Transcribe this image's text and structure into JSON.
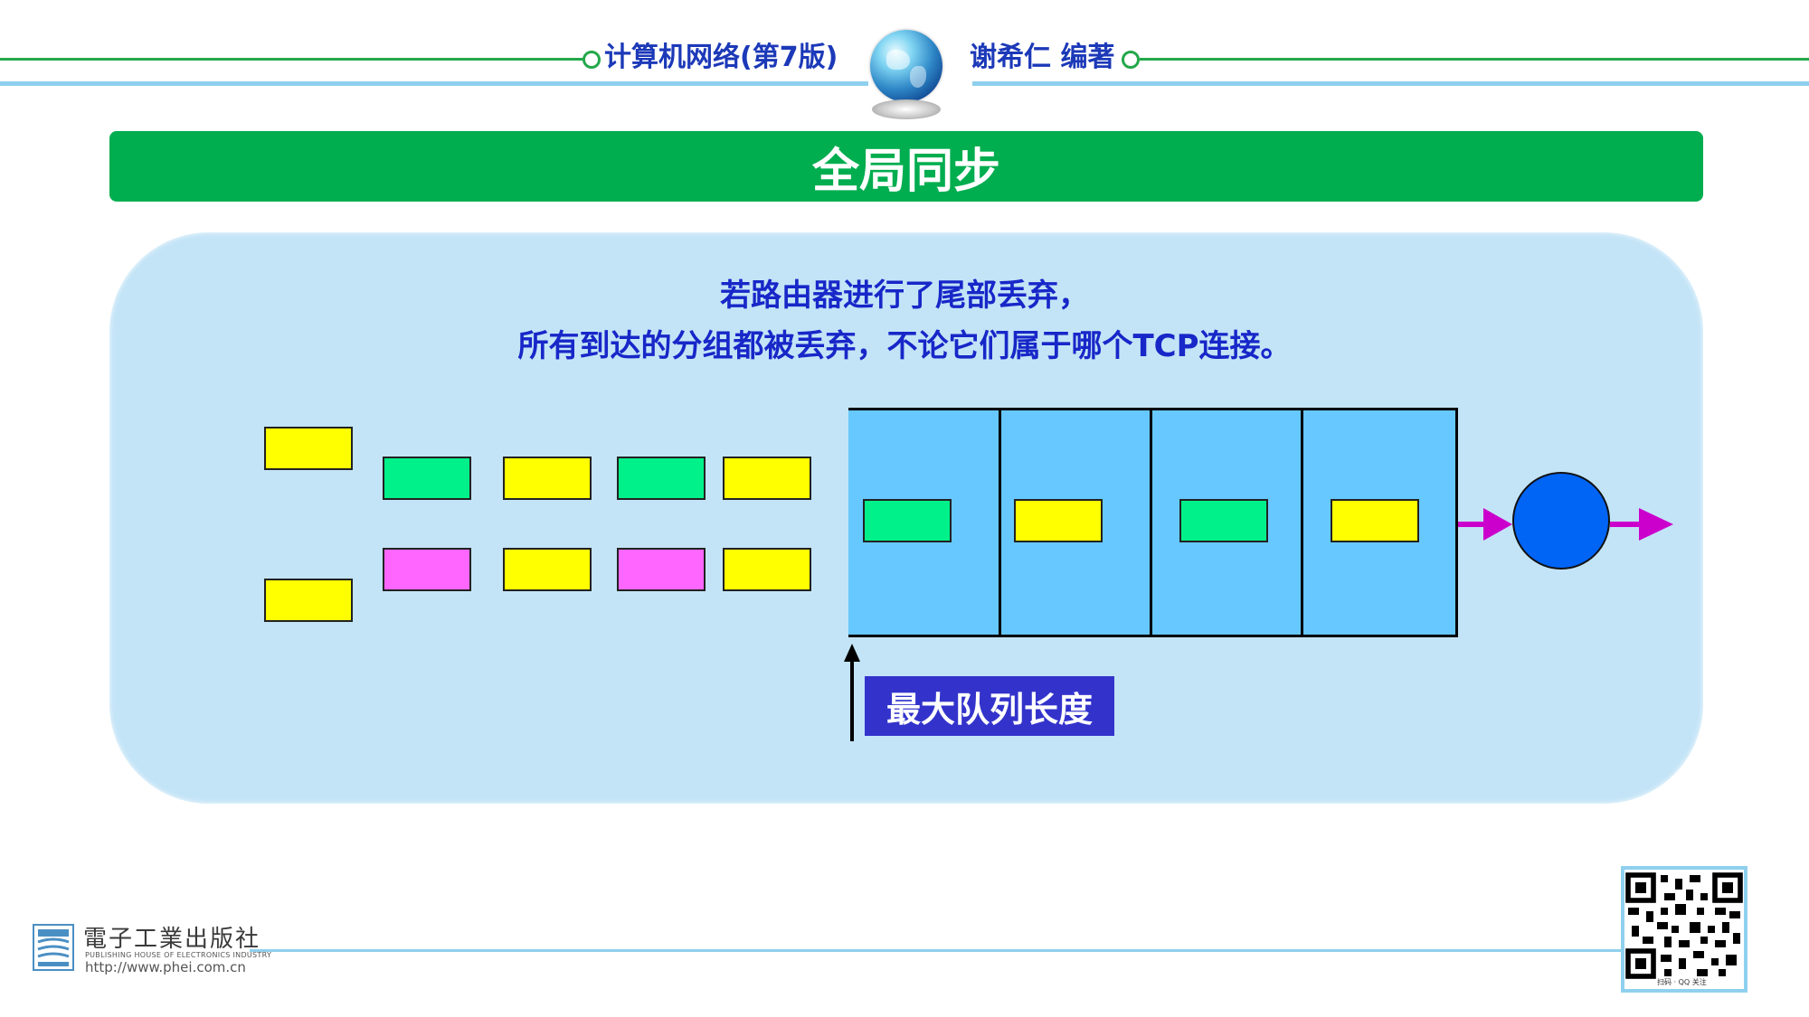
{
  "header": {
    "book_title": "计算机网络(第7版)",
    "author": "谢希仁 编著"
  },
  "slide": {
    "title": "全局同步",
    "description_line1": "若路由器进行了尾部丢弃，",
    "description_line2": "所有到达的分组都被丢弃，不论它们属于哪个TCP连接。"
  },
  "diagram": {
    "max_queue_label": "最大队列长度",
    "incoming_packets": [
      {
        "row": "top",
        "color": "yellow"
      },
      {
        "row": "top",
        "color": "green"
      },
      {
        "row": "top",
        "color": "yellow"
      },
      {
        "row": "top",
        "color": "green"
      },
      {
        "row": "top",
        "color": "yellow"
      },
      {
        "row": "bottom",
        "color": "yellow"
      },
      {
        "row": "bottom",
        "color": "pink"
      },
      {
        "row": "bottom",
        "color": "yellow"
      },
      {
        "row": "bottom",
        "color": "pink"
      },
      {
        "row": "bottom",
        "color": "yellow"
      }
    ],
    "queued_packets": [
      "green",
      "yellow",
      "green",
      "yellow"
    ],
    "colors": {
      "yellow": "#ffff00",
      "green": "#00f08a",
      "pink": "#ff66ff",
      "queue": "#66c8ff",
      "server": "#0064f5",
      "arrow": "#cc00cc"
    }
  },
  "footer": {
    "publisher_cn": "電子工業出版社",
    "publisher_en": "PUBLISHING HOUSE OF ELECTRONICS INDUSTRY",
    "publisher_url": "http://www.phei.com.cn",
    "qr_caption": "扫码 · QQ 关注"
  }
}
